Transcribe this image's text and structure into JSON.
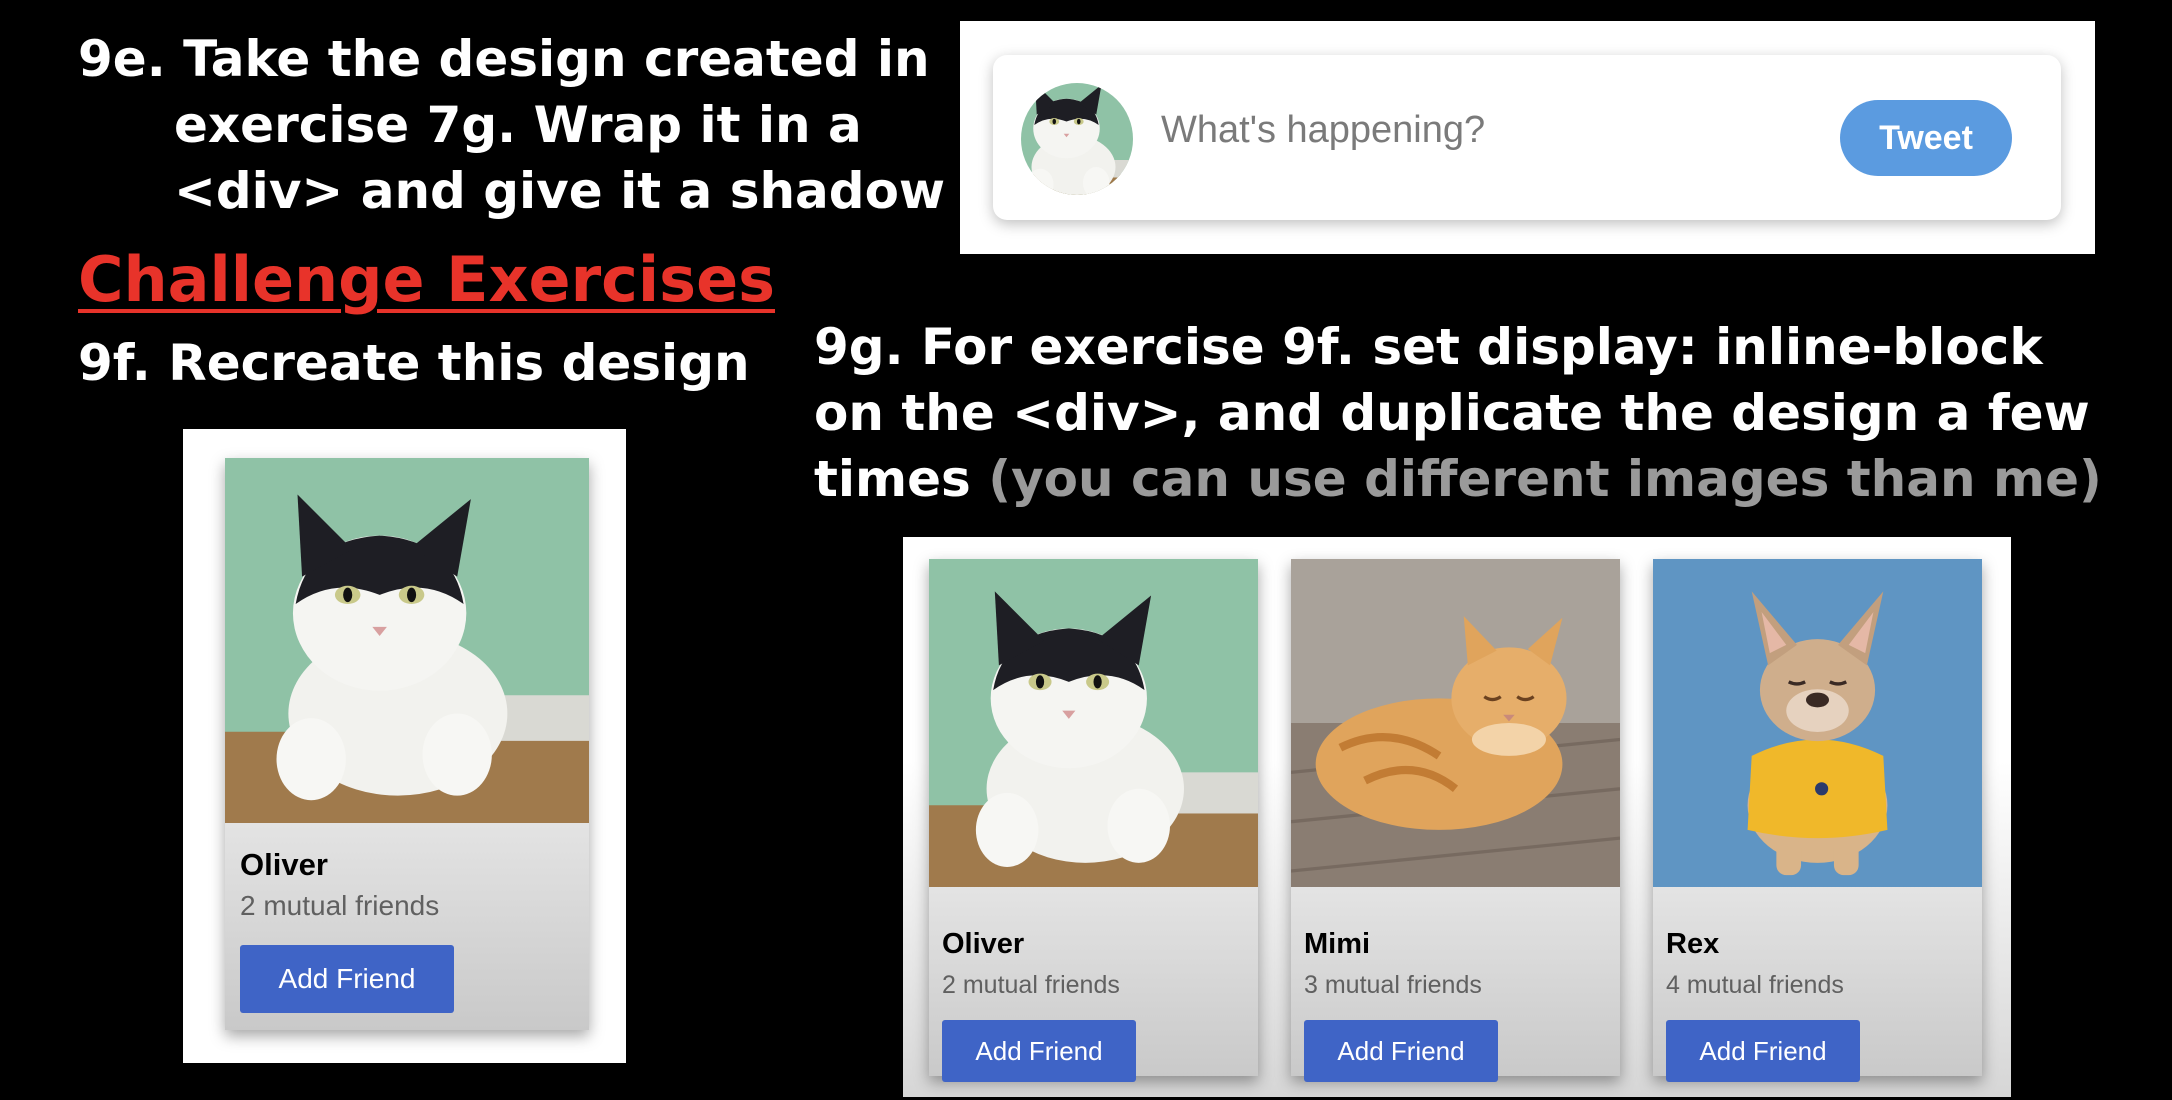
{
  "exercise_9e": {
    "line1": "9e. Take the design created in",
    "line2": "exercise 7g. Wrap it in a",
    "line3": "<div> and give it a shadow"
  },
  "challenge_heading": "Challenge Exercises",
  "exercise_9f": "9f. Recreate this design",
  "exercise_9g": {
    "line1": "9g. For exercise 9f. set display: inline-block",
    "line2": "on the <div>, and duplicate the design a few",
    "line3_start": "times ",
    "line3_muted": "(you can use different images than me)"
  },
  "tweet_box": {
    "placeholder": "What's happening?",
    "button_label": "Tweet",
    "button_color": "#5b9be0"
  },
  "single_card": {
    "name": "Oliver",
    "mutual": "2 mutual friends",
    "button_label": "Add Friend"
  },
  "cards": [
    {
      "name": "Oliver",
      "mutual": "2 mutual friends",
      "button_label": "Add Friend"
    },
    {
      "name": "Mimi",
      "mutual": "3 mutual friends",
      "button_label": "Add Friend"
    },
    {
      "name": "Rex",
      "mutual": "4 mutual friends",
      "button_label": "Add Friend"
    }
  ],
  "colors": {
    "challenge_red": "#e8332a",
    "add_friend_blue": "#3f64c6"
  }
}
